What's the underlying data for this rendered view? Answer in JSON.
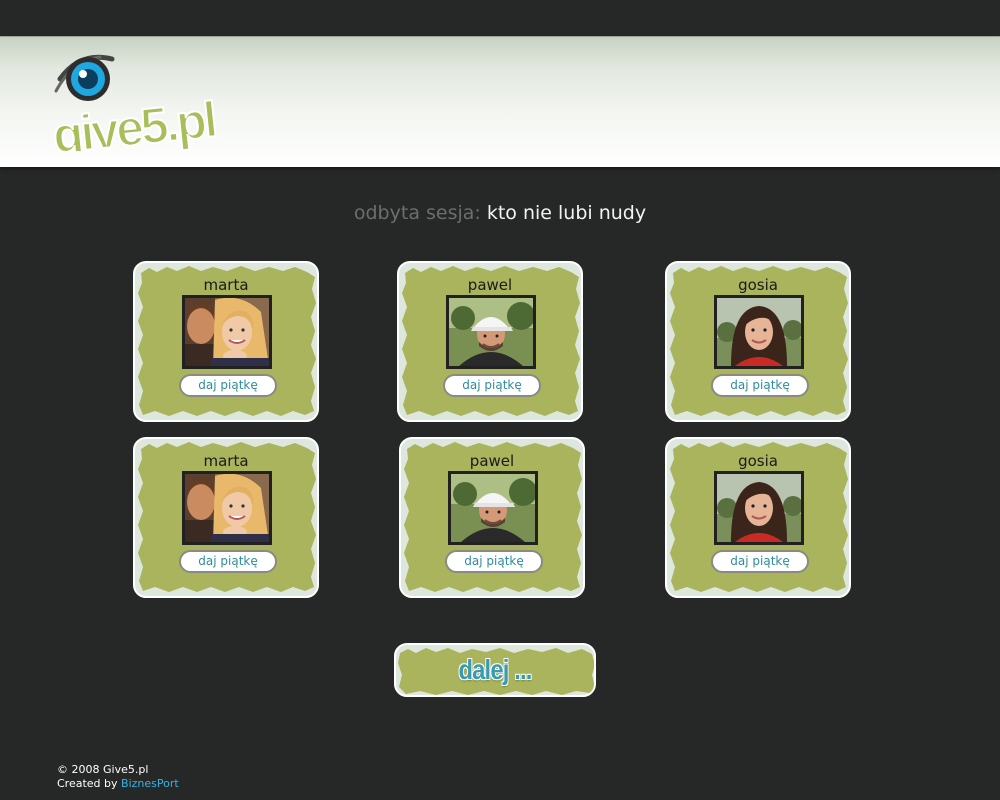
{
  "header": {
    "logo_text": "give5.pl"
  },
  "session": {
    "label": "odbyta sesja:",
    "value": "kto nie lubi nudy"
  },
  "cards": [
    {
      "name": "marta",
      "photo": "photo-marta",
      "button": "daj piątkę"
    },
    {
      "name": "pawel",
      "photo": "photo-pawel",
      "button": "daj piątkę"
    },
    {
      "name": "gosia",
      "photo": "photo-gosia",
      "button": "daj piątkę"
    },
    {
      "name": "marta",
      "photo": "photo-marta",
      "button": "daj piątkę"
    },
    {
      "name": "pawel",
      "photo": "photo-pawel",
      "button": "daj piątkę"
    },
    {
      "name": "gosia",
      "photo": "photo-gosia",
      "button": "daj piątkę"
    }
  ],
  "next_button": {
    "label": "dalej ..."
  },
  "footer": {
    "copyright": "© 2008 Give5.pl",
    "created_prefix": "Created by",
    "created_link": "BiznesPort"
  },
  "colors": {
    "background": "#262727",
    "card_green": "#a9b45c",
    "button_text": "#2e8c9c",
    "link": "#35b4e6"
  }
}
